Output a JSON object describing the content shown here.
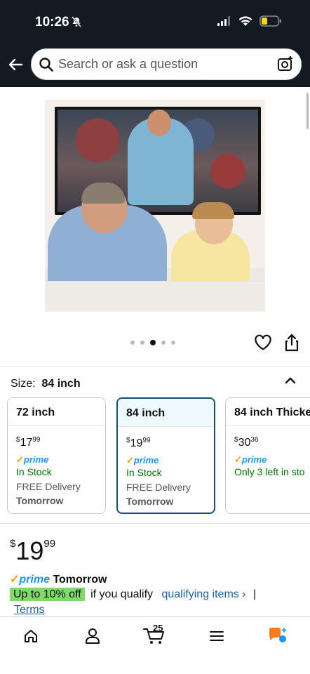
{
  "status_bar": {
    "time": "10:26"
  },
  "search": {
    "placeholder": "Search or ask a question"
  },
  "carousel": {
    "dot_count": 5,
    "active_index": 2
  },
  "size_section": {
    "label": "Size:",
    "selected": "84 inch",
    "options": [
      {
        "name": "72 inch",
        "currency": "$",
        "whole": "17",
        "cents": "99",
        "prime": "prime",
        "stock": "In Stock",
        "delivery": "FREE Delivery",
        "when": "Tomorrow",
        "selected": false
      },
      {
        "name": "84 inch",
        "currency": "$",
        "whole": "19",
        "cents": "99",
        "prime": "prime",
        "stock": "In Stock",
        "delivery": "FREE Delivery",
        "when": "Tomorrow",
        "selected": true
      },
      {
        "name": "84 inch Thicke",
        "currency": "$",
        "whole": "30",
        "cents": "36",
        "prime": "prime",
        "stock": "Only 3 left in sto",
        "delivery": "",
        "when": "",
        "selected": false
      }
    ]
  },
  "price": {
    "currency": "$",
    "whole": "19",
    "cents": "99"
  },
  "prime_delivery": {
    "prime": "prime",
    "when": "Tomorrow"
  },
  "promo": {
    "badge": "Up to 10% off",
    "text": "if you qualify",
    "link": "qualifying items ›",
    "separator": "|",
    "terms": "Terms"
  },
  "bottom_nav": {
    "cart_count": "25"
  },
  "colors": {
    "header_bg": "#131a22",
    "prime_blue": "#1a98ff",
    "prime_check": "#ff9900",
    "link": "#2162a1",
    "in_stock": "#007600",
    "promo_bg": "#7fda69",
    "selected_border": "#17506b"
  }
}
